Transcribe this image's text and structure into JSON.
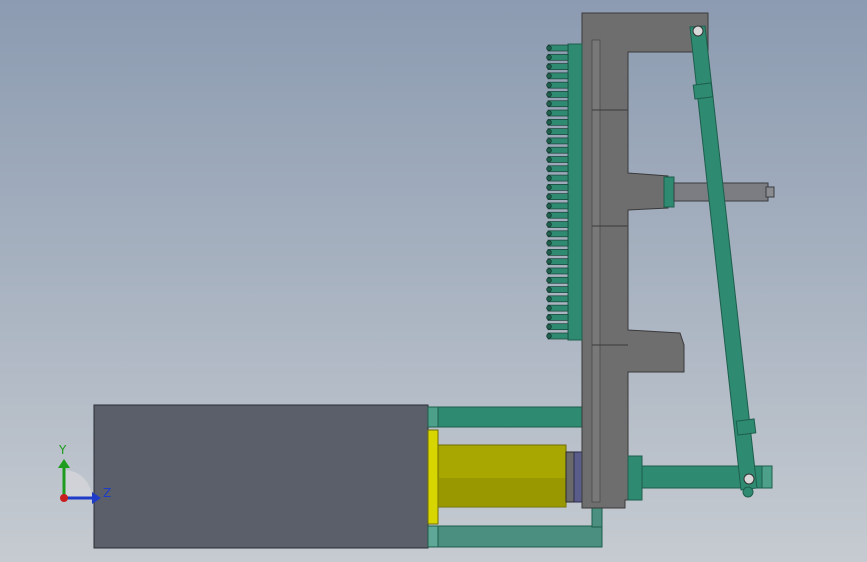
{
  "viewport": {
    "background_top": "#8c9bb1",
    "background_bottom": "#c6cbd1"
  },
  "colors": {
    "plate": "#6e6e6e",
    "plate_edge": "#3a3a3a",
    "housing": "#5a5f69",
    "teal": "#2f8a72",
    "teal_dark": "#1d5e4c",
    "teal_light": "#4da18a",
    "olive": "#a8a600",
    "olive_dark": "#6f6d00",
    "grey_rod": "#7b7d82",
    "blue_ring": "#5a5d8a"
  },
  "triad": {
    "y_label": "Y",
    "z_label": "Z",
    "y_color": "#1e9c1e",
    "z_color": "#1e3cc8",
    "origin_color": "#c81e1e"
  }
}
